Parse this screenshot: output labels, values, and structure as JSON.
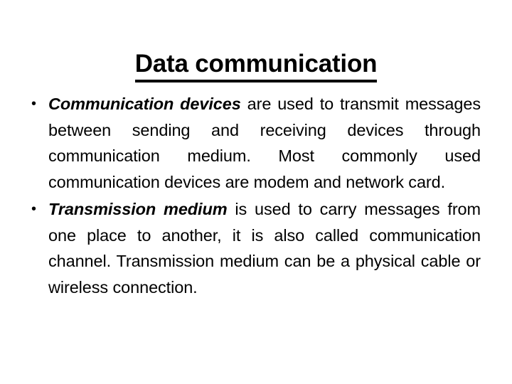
{
  "slide": {
    "title": "Data communication",
    "background_color": "#ffffff",
    "text_color": "#000000",
    "bullet_glyph": "•",
    "bullets": [
      {
        "marker": "•",
        "lead_term": "Communication devices",
        "body": " are used to transmit messages between sending and receiving devices through communication medium. Most commonly used communication devices are modem and network card."
      },
      {
        "marker": "•",
        "lead_term": "Transmission medium",
        "body": " is used to carry messages from one place to another, it is also called communication channel. Transmission medium can be a physical cable or wireless connection."
      }
    ]
  }
}
